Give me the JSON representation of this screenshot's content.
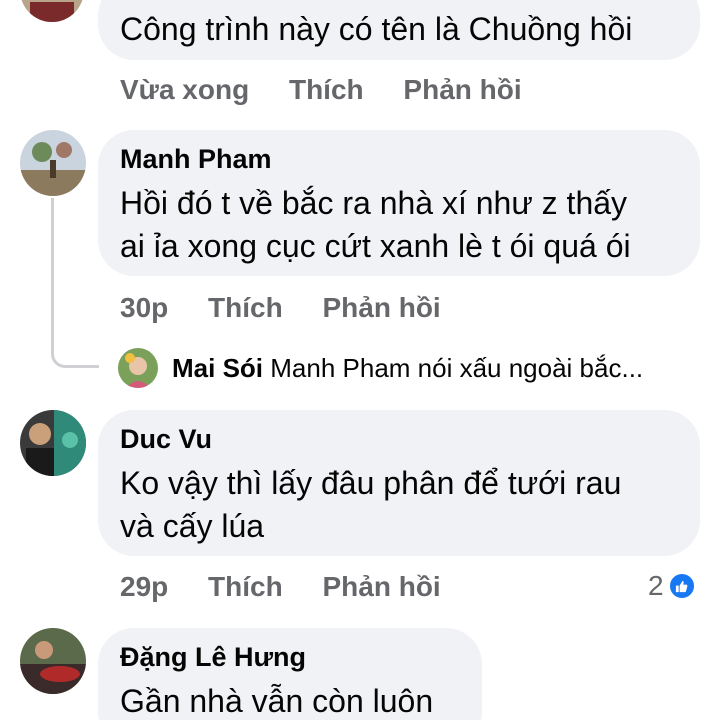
{
  "comments": [
    {
      "author": "",
      "text_lines": [
        "Công trình này có tên là Chuồng hồi"
      ],
      "time": "Vừa xong",
      "like_label": "Thích",
      "reply_label": "Phản hồi"
    },
    {
      "author": "Manh Pham",
      "text_lines": [
        "Hồi đó t về bắc ra nhà xí như z thấy",
        "ai ỉa xong cục cứt xanh lè t ói quá ói"
      ],
      "time": "30p",
      "like_label": "Thích",
      "reply_label": "Phản hồi",
      "reply_preview": {
        "name": "Mai Sói",
        "text": "Manh Pham nói xấu ngoài bắc..."
      }
    },
    {
      "author": "Duc Vu",
      "text_lines": [
        "Ko vậy thì lấy đâu phân để tưới rau",
        "và cấy lúa"
      ],
      "time": "29p",
      "like_label": "Thích",
      "reply_label": "Phản hồi",
      "reaction_count": "2",
      "reaction_icon": "like-icon"
    },
    {
      "author": "Đặng Lê Hưng",
      "text_lines": [
        "Gần nhà vẫn còn luôn"
      ]
    }
  ],
  "colors": {
    "bubble": "#f0f2f5",
    "meta": "#65676b",
    "like_blue": "#1877f2"
  }
}
